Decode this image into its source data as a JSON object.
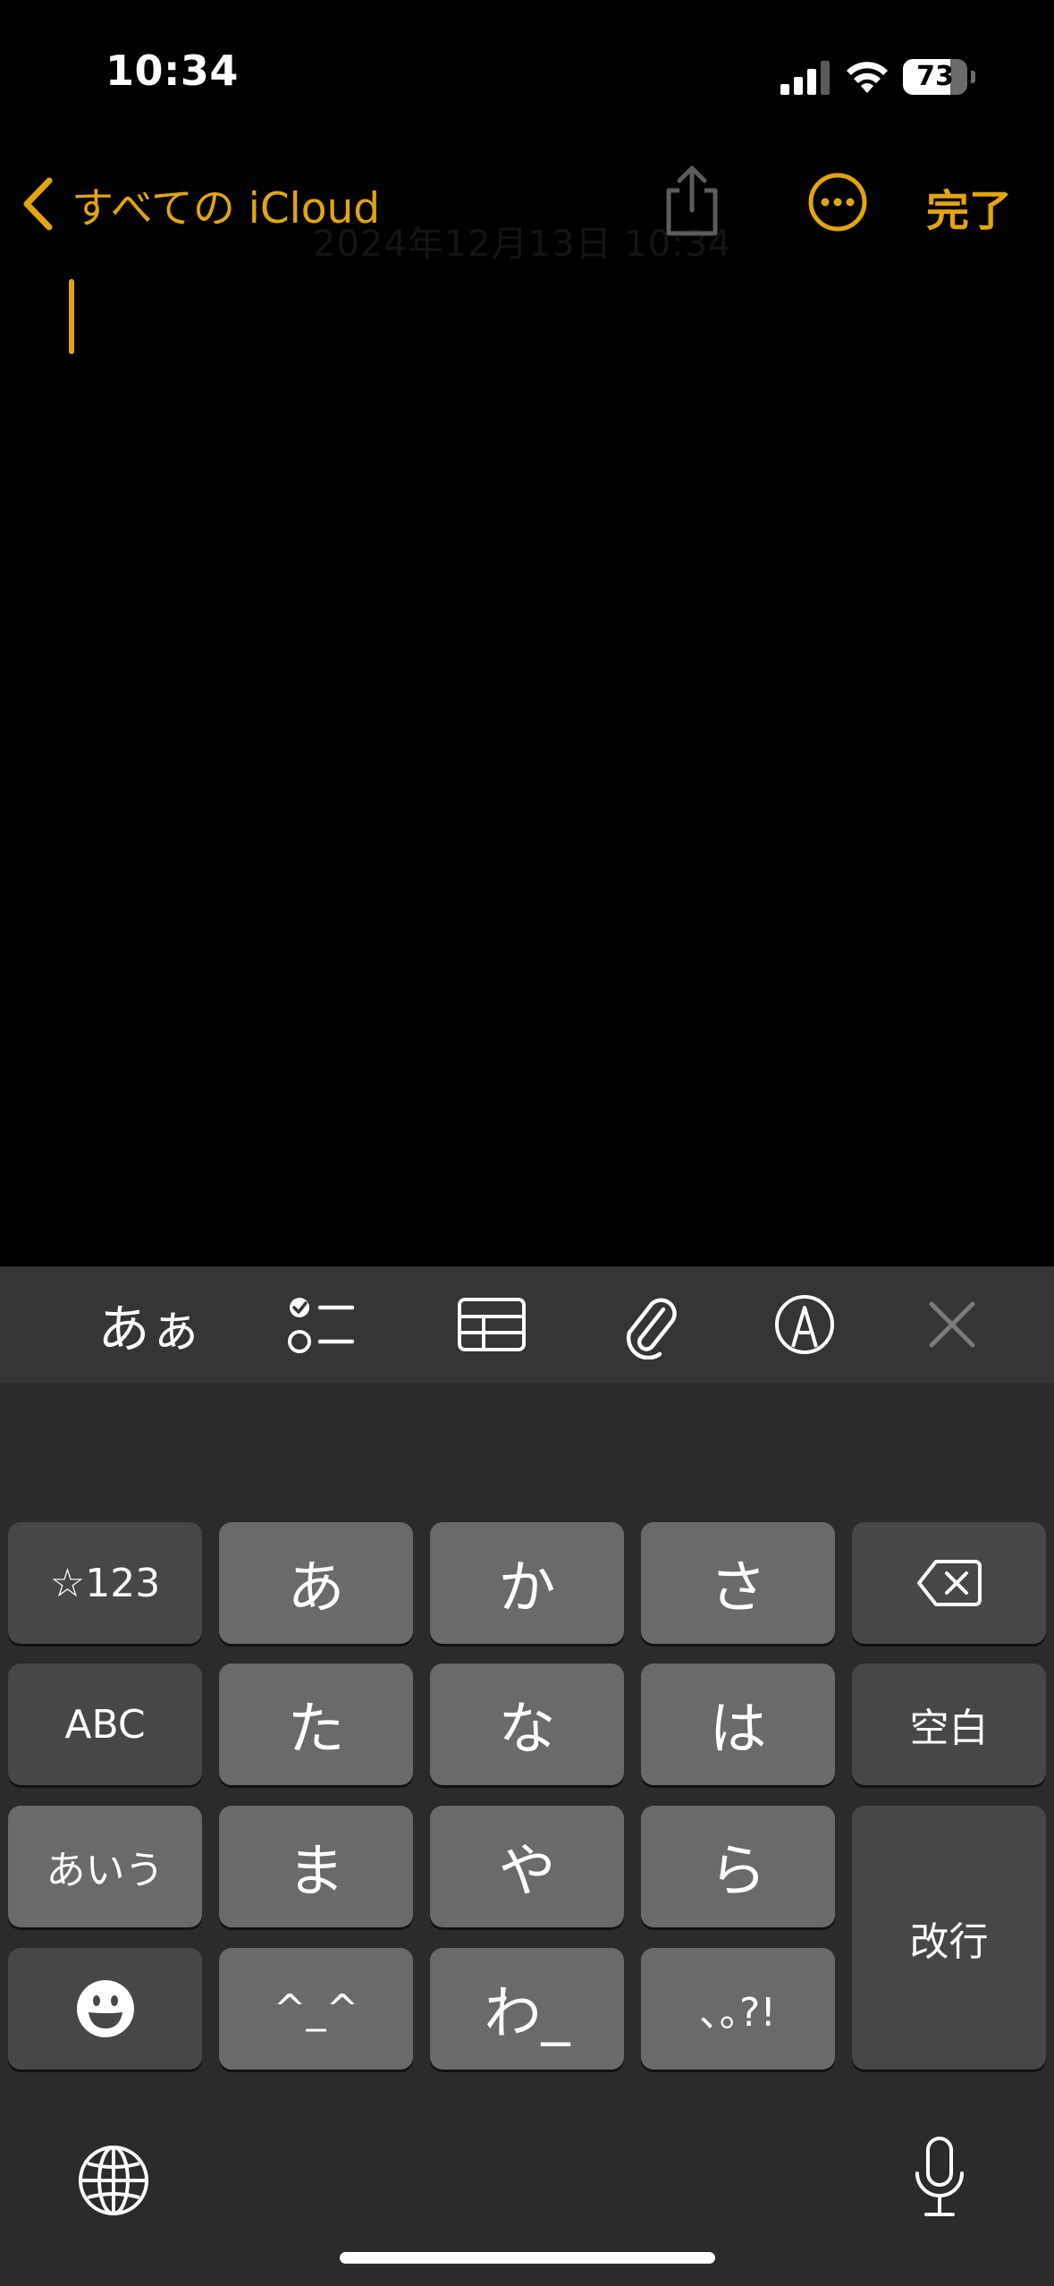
{
  "status": {
    "time": "10:34",
    "battery": "73",
    "battery_level": 0.73
  },
  "nav": {
    "back_label": "すべての iCloud",
    "ghost_date": "2024年12月13日 10:34",
    "done_label": "完了"
  },
  "toolbar": {
    "text_format_label": "あぁ",
    "items": [
      "text-format",
      "checklist",
      "table",
      "attachment",
      "markup",
      "close-keyboard"
    ]
  },
  "keyboard": {
    "row1": [
      "☆123",
      "あ",
      "か",
      "さ"
    ],
    "row2": [
      "ABC",
      "た",
      "な",
      "は",
      "空白"
    ],
    "row3": [
      "あいう",
      "ま",
      "や",
      "ら"
    ],
    "row4": [
      "^_^",
      "わ_",
      "､｡?!"
    ],
    "return_label": "改行"
  },
  "colors": {
    "accent": "#e3a50e",
    "background": "#000000",
    "keyboard": "#2b2b2b"
  }
}
